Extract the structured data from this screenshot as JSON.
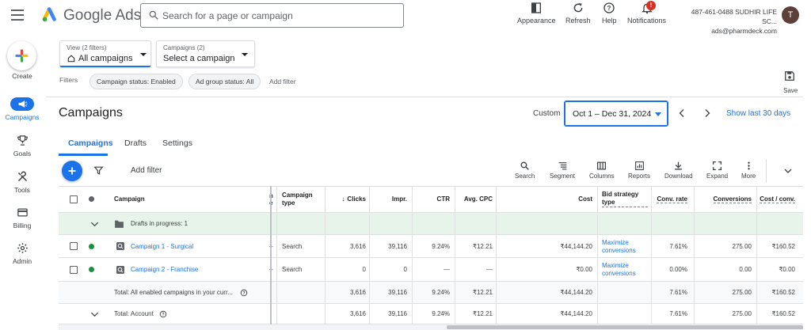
{
  "app": {
    "brand": "Google Ads",
    "search_placeholder": "Search for a page or campaign"
  },
  "top_actions": [
    {
      "label": "Appearance",
      "icon": "appearance-icon"
    },
    {
      "label": "Refresh",
      "icon": "refresh-icon"
    },
    {
      "label": "Help",
      "icon": "help-icon"
    },
    {
      "label": "Notifications",
      "icon": "bell-icon",
      "badge": "!"
    }
  ],
  "account": {
    "line1": "487-461-0488 SUDHIR LIFE SC...",
    "line2": "ads@pharmdeck.com",
    "avatar": "T"
  },
  "nav": [
    {
      "label": "Create"
    },
    {
      "label": "Campaigns",
      "active": true
    },
    {
      "label": "Goals"
    },
    {
      "label": "Tools"
    },
    {
      "label": "Billing"
    },
    {
      "label": "Admin"
    }
  ],
  "view_selector": {
    "label": "View (2 filters)",
    "value": "All campaigns"
  },
  "campaign_selector": {
    "label": "Campaigns (2)",
    "value": "Select a campaign"
  },
  "filters": {
    "label": "Filters",
    "chips": [
      "Campaign status: Enabled",
      "Ad group status: All"
    ],
    "add": "Add filter"
  },
  "save": "Save",
  "page": {
    "title": "Campaigns",
    "date_mode": "Custom",
    "date_range": "Oct 1 – Dec 31, 2024",
    "show_last": "Show last 30 days"
  },
  "tabs": [
    "Campaigns",
    "Drafts",
    "Settings"
  ],
  "toolbar": {
    "add_filter": "Add filter",
    "tools": [
      "Search",
      "Segment",
      "Columns",
      "Reports",
      "Download",
      "Expand",
      "More"
    ]
  },
  "table": {
    "headers": {
      "campaign": "Campaign",
      "campaign_type": "Campaign type",
      "clicks": "Clicks",
      "impr": "Impr.",
      "ctr": "CTR",
      "avg_cpc": "Avg. CPC",
      "cost": "Cost",
      "bid_strategy": "Bid strategy type",
      "conv_rate": "Conv. rate",
      "conversions": "Conversions",
      "cost_conv": "Cost / conv."
    },
    "drafts": "Drafts in progress: 1",
    "rows": [
      {
        "name": "Campaign 1 - Surgical",
        "sep": "–",
        "type": "Search",
        "clicks": "3,616",
        "impr": "39,116",
        "ctr": "9.24%",
        "avg_cpc": "₹12.21",
        "cost": "₹44,144.20",
        "bid1": "Maximize",
        "bid2": "conversions",
        "conv_rate": "7.61%",
        "conversions": "275.00",
        "cost_conv": "₹160.52"
      },
      {
        "name": "Campaign 2 - Franchise",
        "sep": "–",
        "type": "Search",
        "clicks": "0",
        "impr": "0",
        "ctr": "—",
        "avg_cpc": "—",
        "cost": "₹0.00",
        "bid1": "Maximize",
        "bid2": "conversions",
        "conv_rate": "0.00%",
        "conversions": "0.00",
        "cost_conv": "₹0.00"
      }
    ],
    "total_enabled": {
      "label": "Total: All enabled campaigns in your curr...",
      "clicks": "3,616",
      "impr": "39,116",
      "ctr": "9.24%",
      "avg_cpc": "₹12.21",
      "cost": "₹44,144.20",
      "conv_rate": "7.61%",
      "conversions": "275.00",
      "cost_conv": "₹160.52"
    },
    "total_account": {
      "label": "Total: Account",
      "clicks": "3,616",
      "impr": "39,116",
      "ctr": "9.24%",
      "avg_cpc": "₹12.21",
      "cost": "₹44,144.20",
      "conv_rate": "7.61%",
      "conversions": "275.00",
      "cost_conv": "₹160.52"
    }
  }
}
